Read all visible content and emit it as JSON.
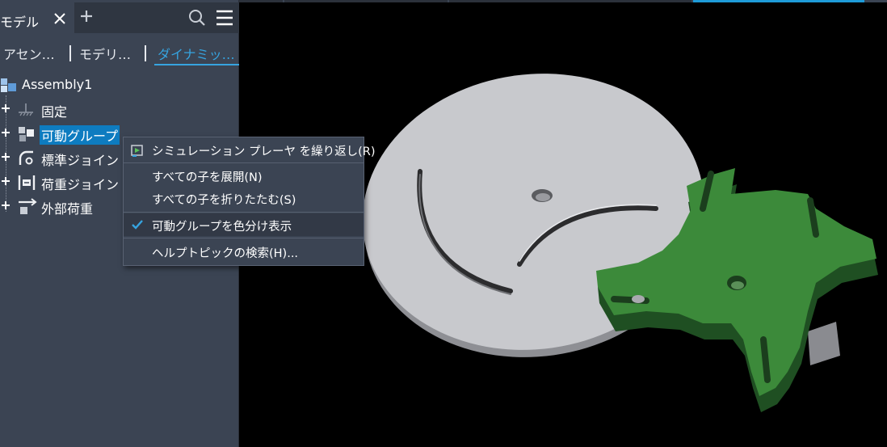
{
  "panel": {
    "title": "モデル",
    "tabs": [
      {
        "label": "アセン…",
        "active": false
      },
      {
        "label": "モデリ…",
        "active": false
      },
      {
        "label": "ダイナミッ…",
        "active": true
      }
    ]
  },
  "tree": {
    "root": "Assembly1",
    "items": [
      {
        "label": "固定",
        "icon": "ground-icon"
      },
      {
        "label": "可動グループ",
        "icon": "mobile-group-icon",
        "selected": true
      },
      {
        "label": "標準ジョイン",
        "icon": "standard-joint-icon"
      },
      {
        "label": "荷重ジョイン",
        "icon": "force-joint-icon"
      },
      {
        "label": "外部荷重",
        "icon": "external-load-icon"
      }
    ]
  },
  "context_menu": {
    "items": [
      {
        "label": "シミュレーション プレーヤ を繰り返し(R)",
        "icon": "simulation-player-icon"
      },
      {
        "label": "すべての子を展開(N)"
      },
      {
        "label": "すべての子を折りたたむ(S)"
      },
      {
        "label": "可動グループを色分け表示",
        "checked": true
      },
      {
        "label": "ヘルプトピックの検索(H)..."
      }
    ]
  },
  "colors": {
    "accent": "#36a4e0",
    "selection": "#0e7cc0",
    "panel_bg": "#3b4453",
    "viewport_bg": "#000000",
    "disk": "#c8c9cd",
    "green_part": "#3c8a3a"
  }
}
